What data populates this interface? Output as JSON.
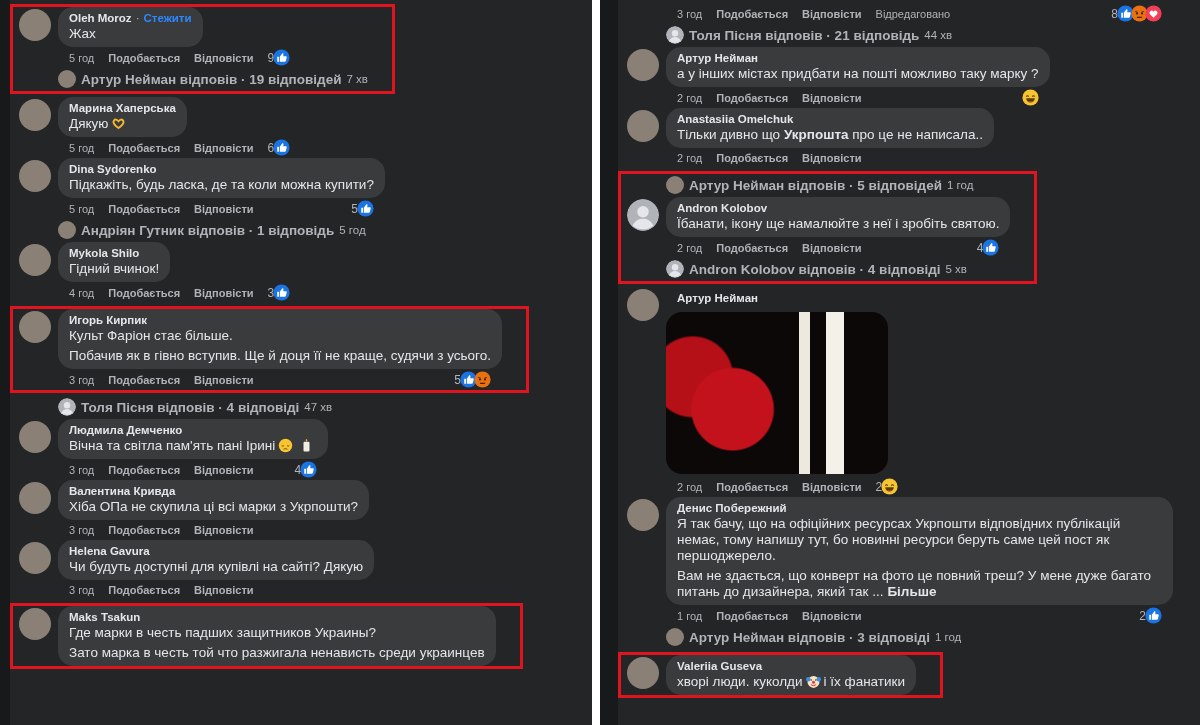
{
  "panels": [
    {
      "sections": [
        {
          "highlighted": true,
          "items": [
            {
              "kind": "comment",
              "author": "Oleh Moroz",
              "separator": "·",
              "follow": "Стежити",
              "avatar": {
                "kind": "photo"
              },
              "body": [
                [
                  {
                    "kind": "text",
                    "text": "Жах"
                  }
                ]
              ],
              "meta": {
                "time": "5 год",
                "like": "Подобається",
                "reply": "Відповісти",
                "count": "9",
                "reactions": [
                  {
                    "kind": "like"
                  }
                ]
              }
            },
            {
              "kind": "replies",
              "avatar": {
                "kind": "photo"
              },
              "text": "Артур Нейман відповів · 19 відповідей",
              "time": "7 хв"
            }
          ]
        },
        {
          "highlighted": false,
          "items": [
            {
              "kind": "comment",
              "author": "Марина Хаперська",
              "avatar": {
                "kind": "photo"
              },
              "body": [
                [
                  {
                    "kind": "text",
                    "text": "Дякую"
                  },
                  {
                    "kind": "emoji_hands"
                  }
                ]
              ],
              "meta": {
                "time": "5 год",
                "like": "Подобається",
                "reply": "Відповісти",
                "count": "6",
                "reactions": [
                  {
                    "kind": "like"
                  }
                ]
              }
            },
            {
              "kind": "comment",
              "author": "Dina Sydorenko",
              "avatar": {
                "kind": "photo"
              },
              "body": [
                [
                  {
                    "kind": "text",
                    "text": "Підкажіть, будь ласка, де та коли можна купити?"
                  }
                ]
              ],
              "meta": {
                "time": "5 год",
                "like": "Подобається",
                "reply": "Відповісти",
                "count": "5",
                "reactions": [
                  {
                    "kind": "like"
                  }
                ]
              }
            },
            {
              "kind": "replies",
              "avatar": {
                "kind": "photo"
              },
              "text": "Андріян Гутник відповів · 1 відповідь",
              "time": "5 год"
            },
            {
              "kind": "comment",
              "author": "Mykola Shilo",
              "avatar": {
                "kind": "photo"
              },
              "body": [
                [
                  {
                    "kind": "text",
                    "text": "Гідний вчинок!"
                  }
                ]
              ],
              "meta": {
                "time": "4 год",
                "like": "Подобається",
                "reply": "Відповісти",
                "count": "3",
                "reactions": [
                  {
                    "kind": "like"
                  }
                ]
              }
            }
          ]
        },
        {
          "highlighted": true,
          "items": [
            {
              "kind": "comment",
              "author": "Игорь Кирпик",
              "avatar": {
                "kind": "photo"
              },
              "body": [
                [
                  {
                    "kind": "text",
                    "text": "Культ Фаріон стає більше."
                  }
                ],
                [
                  {
                    "kind": "text",
                    "text": "Побачив як в гівно вступив. Ще й доця її не краще, судячи з усього."
                  }
                ]
              ],
              "meta": {
                "time": "3 год",
                "like": "Подобається",
                "reply": "Відповісти",
                "count": "5",
                "reactions": [
                  {
                    "kind": "like"
                  },
                  {
                    "kind": "angry"
                  }
                ]
              }
            }
          ]
        },
        {
          "highlighted": false,
          "items": [
            {
              "kind": "replies",
              "avatar": {
                "kind": "default"
              },
              "text": "Толя Пісня відповів · 4 відповіді",
              "time": "47 хв"
            },
            {
              "kind": "comment",
              "author": "Людмила Демченко",
              "avatar": {
                "kind": "photo"
              },
              "body": [
                [
                  {
                    "kind": "text",
                    "text": "Вічна та світла пам'ять пані Ірині"
                  },
                  {
                    "kind": "emoji_pensive"
                  },
                  {
                    "kind": "emoji_candle"
                  }
                ]
              ],
              "meta": {
                "time": "3 год",
                "like": "Подобається",
                "reply": "Відповісти",
                "count": "4",
                "reactions": [
                  {
                    "kind": "like"
                  }
                ]
              }
            },
            {
              "kind": "comment",
              "author": "Валентина Кривда",
              "avatar": {
                "kind": "photo"
              },
              "body": [
                [
                  {
                    "kind": "text",
                    "text": "Хіба ОПа не скупила ці всі марки з Укрпошти?"
                  }
                ]
              ],
              "meta": {
                "time": "3 год",
                "like": "Подобається",
                "reply": "Відповісти"
              }
            },
            {
              "kind": "comment",
              "author": "Helena Gavura",
              "avatar": {
                "kind": "photo"
              },
              "body": [
                [
                  {
                    "kind": "text",
                    "text": "Чи будуть доступні для купівлі на сайті? Дякую"
                  }
                ]
              ],
              "meta": {
                "time": "3 год",
                "like": "Подобається",
                "reply": "Відповісти"
              }
            }
          ]
        },
        {
          "highlighted": true,
          "items": [
            {
              "kind": "comment",
              "author": "Maks Tsakun",
              "avatar": {
                "kind": "photo"
              },
              "body": [
                [
                  {
                    "kind": "text",
                    "text": "Где марки в честь падших защитников Украины?"
                  }
                ],
                [
                  {
                    "kind": "text",
                    "text": "Зато марка в честь той что разжигала ненависть среди украинцев"
                  }
                ]
              ]
            }
          ]
        }
      ]
    },
    {
      "sections": [
        {
          "highlighted": false,
          "items": [
            {
              "kind": "meta",
              "meta": {
                "time": "3 год",
                "like": "Подобається",
                "reply": "Відповісти",
                "edited": "Відредаговано",
                "count": "8",
                "reactions": [
                  {
                    "kind": "like"
                  },
                  {
                    "kind": "angry"
                  },
                  {
                    "kind": "love"
                  }
                ]
              }
            },
            {
              "kind": "replies",
              "avatar": {
                "kind": "default"
              },
              "text": "Толя Пісня відповів · 21 відповідь",
              "time": "44 хв"
            },
            {
              "kind": "comment",
              "author": "Артур Нейман",
              "avatar": {
                "kind": "photo"
              },
              "body": [
                [
                  {
                    "kind": "text",
                    "text": "а у інших містах придбати на пошті можливо таку марку ?"
                  }
                ]
              ],
              "meta": {
                "time": "2 год",
                "like": "Подобається",
                "reply": "Відповісти",
                "reactions": [
                  {
                    "kind": "haha"
                  }
                ]
              }
            },
            {
              "kind": "comment",
              "author": "Anastasiia Omelchuk",
              "avatar": {
                "kind": "photo"
              },
              "body": [
                [
                  {
                    "kind": "text",
                    "text": "Тільки дивно що **Укрпошта** про це не написала.."
                  }
                ]
              ],
              "meta": {
                "time": "2 год",
                "like": "Подобається",
                "reply": "Відповісти"
              }
            }
          ]
        },
        {
          "highlighted": true,
          "items": [
            {
              "kind": "replies",
              "avatar": {
                "kind": "photo"
              },
              "text": "Артур Нейман відповів · 5 відповідей",
              "time": "1 год"
            },
            {
              "kind": "comment",
              "author": "Andron Kolobov",
              "avatar": {
                "kind": "default"
              },
              "body": [
                [
                  {
                    "kind": "text",
                    "text": "Їбанати, ікону ще намалюйте з неї і зробіть святою."
                  }
                ]
              ],
              "meta": {
                "time": "2 год",
                "like": "Подобається",
                "reply": "Відповісти",
                "count": "4",
                "reactions": [
                  {
                    "kind": "like"
                  }
                ]
              }
            },
            {
              "kind": "replies",
              "avatar": {
                "kind": "default"
              },
              "text": "Andron Kolobov відповів · 4 відповіді",
              "time": "5 хв"
            }
          ]
        },
        {
          "highlighted": false,
          "items": [
            {
              "kind": "comment",
              "author": "Артур Нейман",
              "avatar": {
                "kind": "photo"
              },
              "attachment": {
                "kind": "photo"
              },
              "meta": {
                "time": "2 год",
                "like": "Подобається",
                "reply": "Відповісти",
                "count": "2",
                "reactions": [
                  {
                    "kind": "haha"
                  }
                ]
              }
            },
            {
              "kind": "comment",
              "author": "Денис Побережний",
              "avatar": {
                "kind": "photo"
              },
              "body": [
                [
                  {
                    "kind": "text",
                    "text": "Я так бачу, що на офіційних ресурсах Укрпошти відповідних публікацій немає, тому напишу тут, бо новинні ресурси беруть саме цей пост як першоджерело."
                  }
                ],
                [
                  {
                    "kind": "text",
                    "text": "Вам не здається, що конверт на фото це повний треш? У мене дуже багато питань до дизайнера, який так ..."
                  },
                  {
                    "kind": "link",
                    "text": "Більше"
                  }
                ]
              ],
              "meta": {
                "time": "1 год",
                "like": "Подобається",
                "reply": "Відповісти",
                "count": "2",
                "reactions": [
                  {
                    "kind": "like"
                  }
                ]
              }
            },
            {
              "kind": "replies",
              "avatar": {
                "kind": "photo"
              },
              "text": "Артур Нейман відповів · 3 відповіді",
              "time": "1 год"
            }
          ]
        },
        {
          "highlighted": true,
          "items": [
            {
              "kind": "comment",
              "author": "Valeriia Guseva",
              "avatar": {
                "kind": "photo"
              },
              "body": [
                [
                  {
                    "kind": "text",
                    "text": "хворі люди. куколди"
                  },
                  {
                    "kind": "emoji_clown"
                  },
                  {
                    "kind": "text",
                    "text": "і їх фанатики"
                  }
                ]
              ]
            }
          ]
        }
      ]
    }
  ]
}
